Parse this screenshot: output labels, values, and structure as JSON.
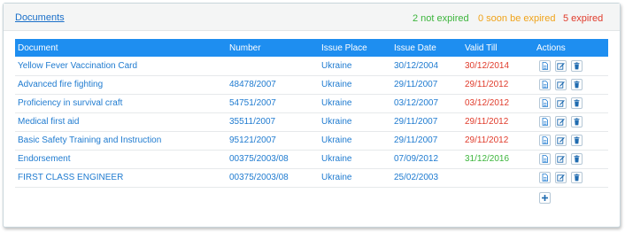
{
  "header": {
    "title": "Documents",
    "stats": {
      "not_expired": "2 not expired",
      "soon_expired": "0 soon be expired",
      "expired": "5 expired"
    }
  },
  "table": {
    "columns": [
      "Document",
      "Number",
      "Issue Place",
      "Issue Date",
      "Valid Till",
      "Actions"
    ],
    "rows": [
      {
        "document": "Yellow Fever Vaccination Card",
        "number": "",
        "issue_place": "Ukraine",
        "issue_date": "30/12/2004",
        "valid_till": "30/12/2014",
        "status": "expired"
      },
      {
        "document": "Advanced fire fighting",
        "number": "48478/2007",
        "issue_place": "Ukraine",
        "issue_date": "29/11/2007",
        "valid_till": "29/11/2012",
        "status": "expired"
      },
      {
        "document": "Proficiency in survival craft",
        "number": "54751/2007",
        "issue_place": "Ukraine",
        "issue_date": "03/12/2007",
        "valid_till": "03/12/2012",
        "status": "expired"
      },
      {
        "document": "Medical first aid",
        "number": "35511/2007",
        "issue_place": "Ukraine",
        "issue_date": "29/11/2007",
        "valid_till": "29/11/2012",
        "status": "expired"
      },
      {
        "document": "Basic Safety Training and Instruction",
        "number": "95121/2007",
        "issue_place": "Ukraine",
        "issue_date": "29/11/2007",
        "valid_till": "29/11/2012",
        "status": "expired"
      },
      {
        "document": "Endorsement",
        "number": "00375/2003/08",
        "issue_place": "Ukraine",
        "issue_date": "07/09/2012",
        "valid_till": "31/12/2016",
        "status": "valid"
      },
      {
        "document": "FIRST CLASS ENGINEER",
        "number": "00375/2003/08",
        "issue_place": "Ukraine",
        "issue_date": "25/02/2003",
        "valid_till": "",
        "status": "none"
      }
    ],
    "row_actions": [
      "view-icon",
      "edit-icon",
      "delete-icon"
    ],
    "add_icon": "plus-icon"
  },
  "colors": {
    "header_bar": "#1e8ef0",
    "link": "#1f7bd0",
    "valid": "#3cb53c",
    "soon": "#f0a31a",
    "expired": "#e03b2b"
  }
}
